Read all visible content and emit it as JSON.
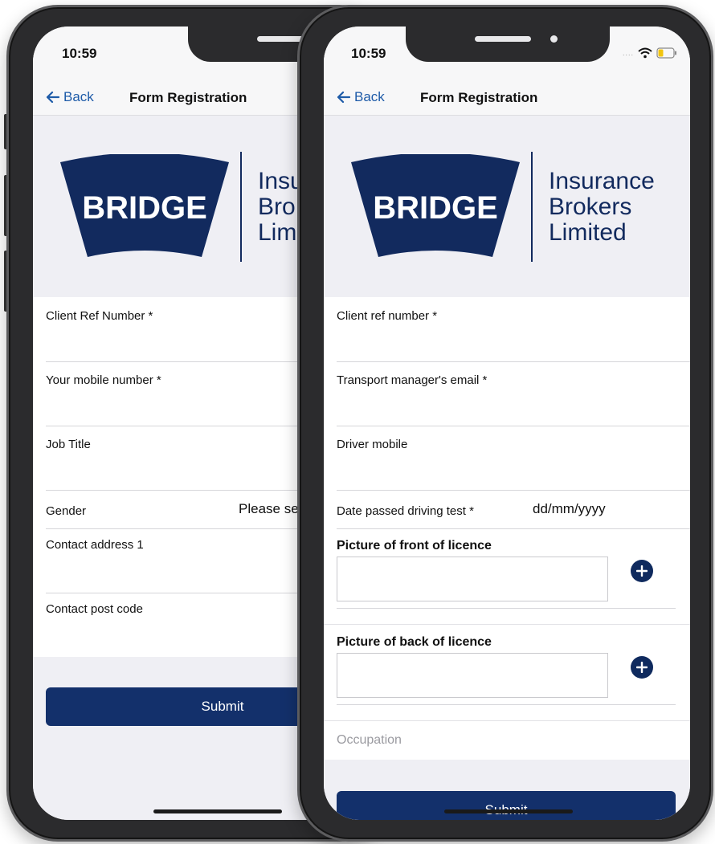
{
  "status_bar": {
    "time": "10:59"
  },
  "nav": {
    "back_label": "Back",
    "title": "Form Registration"
  },
  "logo": {
    "badge": "BRIDGE",
    "line1": "Insurance",
    "line2": "Brokers",
    "line3": "Limited",
    "line1_clip": "Insu",
    "line2_clip": "Bro",
    "line3_clip": "Lim"
  },
  "colors": {
    "brand_navy": "#122a5e",
    "link_blue": "#1e5ba8",
    "submit_bg": "#13306b"
  },
  "back_phone": {
    "fields": [
      {
        "label": "Client Ref Number *"
      },
      {
        "label": "Your mobile number *"
      },
      {
        "label": "Job Title"
      },
      {
        "label": "Gender",
        "value": "Please se"
      },
      {
        "label": "Contact address 1"
      },
      {
        "label": "Contact post code"
      }
    ],
    "submit_label": "Submit"
  },
  "front_phone": {
    "fields": [
      {
        "label": "Client ref number *"
      },
      {
        "label": "Transport manager's email *"
      },
      {
        "label": "Driver mobile"
      },
      {
        "label": "Date passed driving test *",
        "value": "dd/mm/yyyy"
      }
    ],
    "front_licence": {
      "title": "Picture of front of licence"
    },
    "back_licence": {
      "title": "Picture of back of licence"
    },
    "occupation_placeholder": "Occupation",
    "submit_label": "Submit"
  }
}
